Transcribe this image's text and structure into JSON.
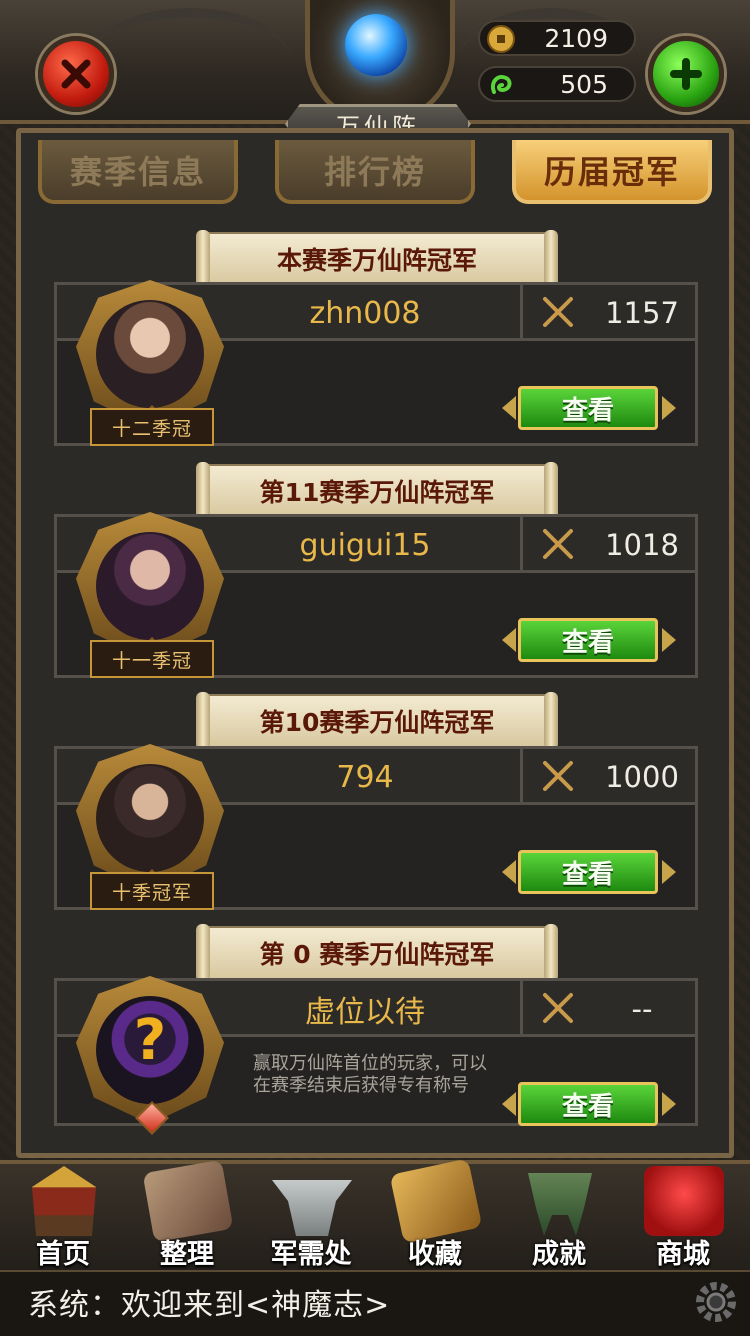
{
  "header": {
    "title": "万仙阵",
    "gold_amount": "2109",
    "jade_amount": "505"
  },
  "tabs": [
    {
      "label": "赛季信息",
      "active": false
    },
    {
      "label": "排行榜",
      "active": false
    },
    {
      "label": "历届冠军",
      "active": true
    }
  ],
  "champions": [
    {
      "banner": "本赛季万仙阵冠军",
      "name": "zhn008",
      "score": "1157",
      "plate": "十二季冠",
      "button": "查看"
    },
    {
      "banner": "第11赛季万仙阵冠军",
      "name": "guigui15",
      "score": "1018",
      "plate": "十一季冠",
      "button": "查看"
    },
    {
      "banner": "第10赛季万仙阵冠军",
      "name": "794",
      "score": "1000",
      "plate": "十季冠军",
      "button": "查看"
    },
    {
      "banner": "第 0 赛季万仙阵冠军",
      "name": "虚位以待",
      "score": "--",
      "description": "赢取万仙阵首位的玩家，可以在赛季结束后获得专有称号",
      "button": "查看"
    }
  ],
  "nav": [
    {
      "label": "首页",
      "icon": "house-icon"
    },
    {
      "label": "整理",
      "icon": "bag-icon"
    },
    {
      "label": "军需处",
      "icon": "anvil-icon"
    },
    {
      "label": "收藏",
      "icon": "book-icon"
    },
    {
      "label": "成就",
      "icon": "cauldron-icon"
    },
    {
      "label": "商城",
      "icon": "treasure-bag-icon"
    }
  ],
  "system_message": "系统：欢迎来到<神魔志>"
}
